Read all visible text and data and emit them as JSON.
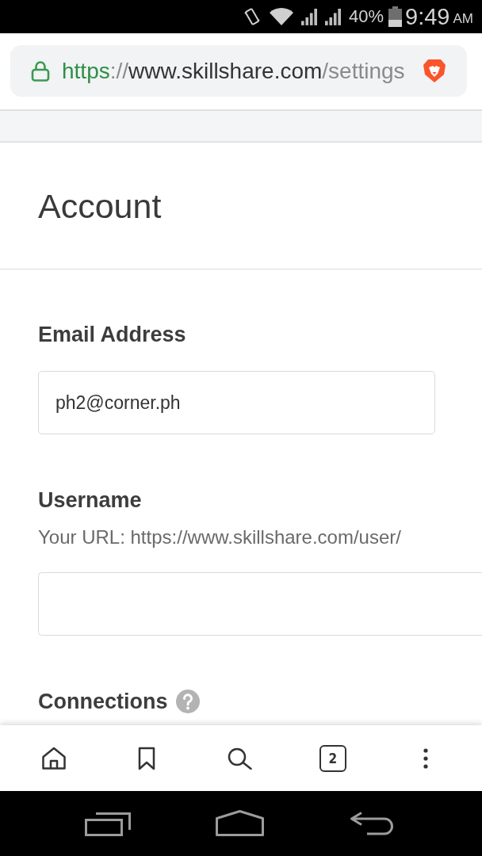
{
  "status_bar": {
    "battery": "40%",
    "time": "9:49",
    "meridiem": "AM"
  },
  "address_bar": {
    "url": [
      {
        "kind": "scheme",
        "text": "https"
      },
      {
        "kind": "separator",
        "text": "://"
      },
      {
        "kind": "host",
        "text": "www.skillshare.com"
      },
      {
        "kind": "path",
        "text": "/settings"
      }
    ]
  },
  "page": {
    "title": "Account",
    "sections": [
      {
        "kind": "field",
        "label": "Email Address",
        "value": "ph2@corner.ph"
      },
      {
        "kind": "url-field",
        "label": "Username",
        "hint": "Your URL: https://www.skillshare.com/user/"
      },
      {
        "kind": "help-heading",
        "label": "Connections"
      }
    ]
  },
  "toolbar": {
    "tab_count": "2"
  }
}
